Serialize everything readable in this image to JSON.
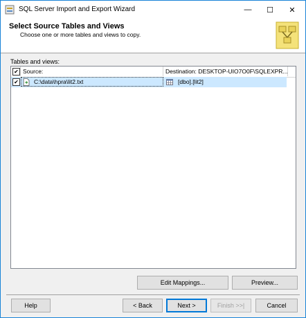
{
  "window": {
    "title": "SQL Server Import and Export Wizard",
    "controls": {
      "minimize": "—",
      "maximize": "☐",
      "close": "✕"
    }
  },
  "header": {
    "title": "Select Source Tables and Views",
    "subtitle": "Choose one or more tables and views to copy.",
    "icon": "wizard-icon"
  },
  "tables": {
    "label": "Tables and views:",
    "columns": {
      "source": "Source:",
      "destination": "Destination: DESKTOP-UIO7O0F\\SQLEXPR..."
    },
    "header_checked": true,
    "rows": [
      {
        "checked": true,
        "source": "C:\\data\\hpra\\lit2.txt",
        "destination": "[dbo].[lit2]"
      }
    ]
  },
  "buttons": {
    "edit_mappings": "Edit Mappings...",
    "preview": "Preview...",
    "help": "Help",
    "back": "< Back",
    "next": "Next >",
    "finish": "Finish >>|",
    "cancel": "Cancel"
  },
  "colors": {
    "accent": "#0078d7",
    "selected_row": "#cce8ff",
    "window_border": "#1883d7"
  }
}
